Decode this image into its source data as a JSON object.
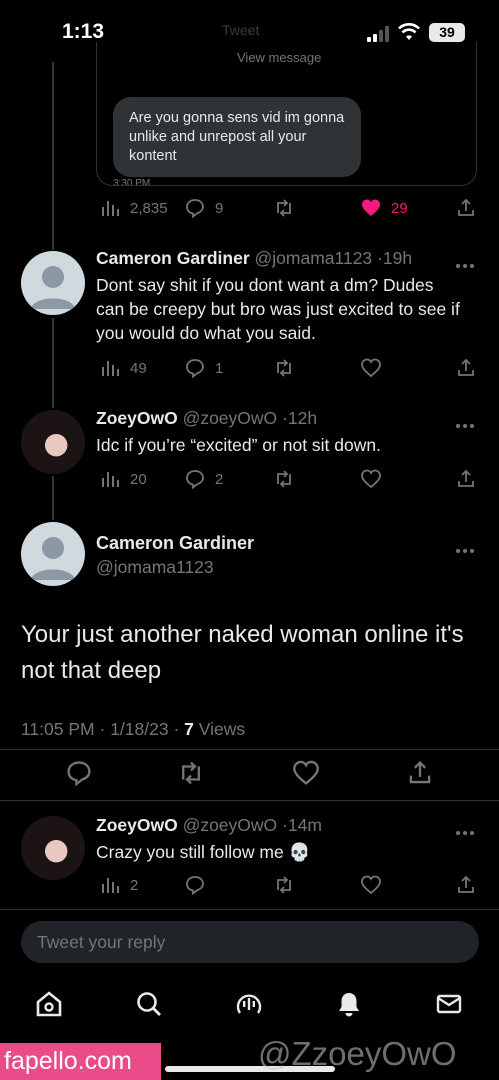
{
  "status_bar": {
    "time": "1:13",
    "ghost_title": "Tweet",
    "battery": "39"
  },
  "quoted_card": {
    "view_message": "View message",
    "dm_text": "Are you gonna sens vid im gonna unlike and unrepost all your kontent",
    "dm_time": "3:30 PM",
    "stats": {
      "views": "2,835",
      "replies": "9",
      "likes": "29"
    }
  },
  "tweets": [
    {
      "name": "Cameron Gardiner",
      "handle": "@jomama1123",
      "time": "19h",
      "text": "Dont say shit if you dont want a dm? Dudes can be creepy but bro was just excited to see if you would do what you said.",
      "views": "49",
      "replies": "1"
    },
    {
      "name": "ZoeyOwO",
      "handle": "@zoeyOwO",
      "time": "12h",
      "text": "Idc if you’re “excited” or not sit down.",
      "views": "20",
      "replies": "2"
    }
  ],
  "focal_tweet": {
    "name": "Cameron Gardiner",
    "handle": "@jomama1123",
    "text": "Your just another naked woman online it's not that deep",
    "time": "11:05 PM",
    "date": "1/18/23",
    "views": "7",
    "views_label": "Views"
  },
  "reply_tweet": {
    "name": "ZoeyOwO",
    "handle": "@zoeyOwO",
    "time": "14m",
    "text": "Crazy you still follow me 💀",
    "views": "2"
  },
  "reply_box": {
    "placeholder": "Tweet your reply"
  },
  "nav": [
    "home-icon",
    "search-icon",
    "spaces-icon",
    "notifications-icon",
    "messages-icon"
  ],
  "watermarks": {
    "left": "fapello.com",
    "right": "@ZzoeyOwO"
  },
  "colors": {
    "like": "#f91880",
    "muted": "#71767b",
    "text": "#e7e9ea",
    "background": "#000000",
    "watermark": "#ea4c89"
  }
}
